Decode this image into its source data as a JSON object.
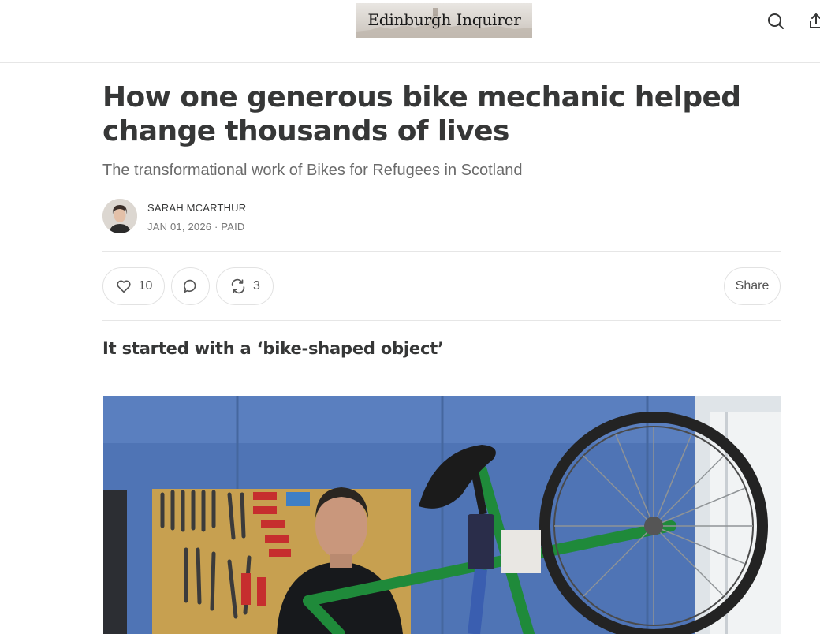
{
  "header": {
    "logo_text": "Edinburgh Inquirer",
    "search_icon": "search-icon",
    "share_icon": "share-upload-icon"
  },
  "article": {
    "title": "How one generous bike mechanic helped change thousands of lives",
    "subtitle": "The transformational work of Bikes for Refugees in Scotland",
    "author": "SARAH MCARTHUR",
    "meta": "JAN 01, 2026 · PAID",
    "section_heading": "It started with a ‘bike-shaped object’"
  },
  "actions": {
    "likes": "10",
    "restacks": "3",
    "share_label": "Share",
    "like_icon": "heart-icon",
    "comment_icon": "comment-icon",
    "restack_icon": "restack-icon"
  },
  "colors": {
    "text": "#363737",
    "muted": "#6b6b6b",
    "border": "#e2e2e2"
  }
}
